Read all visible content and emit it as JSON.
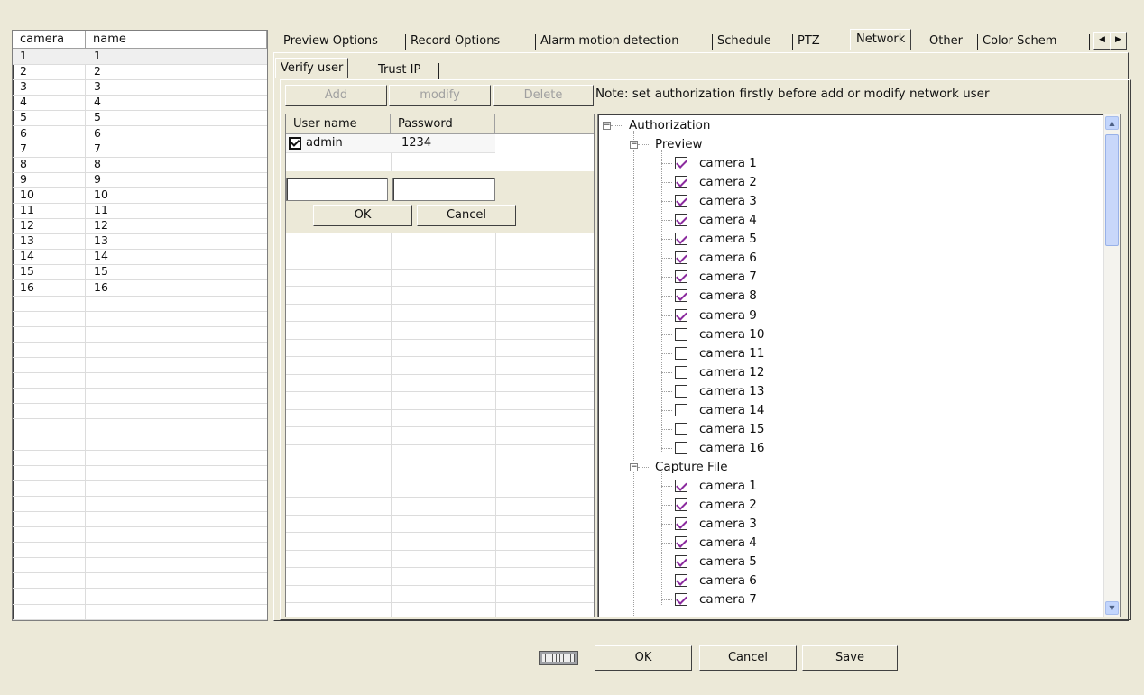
{
  "camera_list": {
    "headers": {
      "camera": "camera",
      "name": "name"
    },
    "rows": [
      {
        "camera": "1",
        "name": "1"
      },
      {
        "camera": "2",
        "name": "2"
      },
      {
        "camera": "3",
        "name": "3"
      },
      {
        "camera": "4",
        "name": "4"
      },
      {
        "camera": "5",
        "name": "5"
      },
      {
        "camera": "6",
        "name": "6"
      },
      {
        "camera": "7",
        "name": "7"
      },
      {
        "camera": "8",
        "name": "8"
      },
      {
        "camera": "9",
        "name": "9"
      },
      {
        "camera": "10",
        "name": "10"
      },
      {
        "camera": "11",
        "name": "11"
      },
      {
        "camera": "12",
        "name": "12"
      },
      {
        "camera": "13",
        "name": "13"
      },
      {
        "camera": "14",
        "name": "14"
      },
      {
        "camera": "15",
        "name": "15"
      },
      {
        "camera": "16",
        "name": "16"
      }
    ]
  },
  "tabs": [
    "Preview Options",
    "Record Options",
    "Alarm motion detection",
    "Schedule",
    "PTZ",
    "Network",
    "Other",
    "Color Schem"
  ],
  "active_tab": "Network",
  "subtabs": {
    "verify_user": "Verify user",
    "trust_ip": "Trust IP"
  },
  "user_buttons": {
    "add": "Add",
    "modify": "modify",
    "delete": "Delete"
  },
  "note": "Note: set authorization firstly before add or modify network user",
  "user_grid": {
    "headers": {
      "username": "User name",
      "password": "Password"
    },
    "rows": [
      {
        "username": "admin",
        "password": "1234",
        "checked": true
      }
    ]
  },
  "edit_buttons": {
    "ok": "OK",
    "cancel": "Cancel"
  },
  "tree": {
    "root": "Authorization",
    "preview": {
      "label": "Preview",
      "items": [
        {
          "label": "camera 1",
          "checked": true
        },
        {
          "label": "camera 2",
          "checked": true
        },
        {
          "label": "camera 3",
          "checked": true
        },
        {
          "label": "camera 4",
          "checked": true
        },
        {
          "label": "camera 5",
          "checked": true
        },
        {
          "label": "camera 6",
          "checked": true
        },
        {
          "label": "camera 7",
          "checked": true
        },
        {
          "label": "camera 8",
          "checked": true
        },
        {
          "label": "camera 9",
          "checked": true
        },
        {
          "label": "camera 10",
          "checked": false
        },
        {
          "label": "camera 11",
          "checked": false
        },
        {
          "label": "camera 12",
          "checked": false
        },
        {
          "label": "camera 13",
          "checked": false
        },
        {
          "label": "camera 14",
          "checked": false
        },
        {
          "label": "camera 15",
          "checked": false
        },
        {
          "label": "camera 16",
          "checked": false
        }
      ]
    },
    "capture": {
      "label": "Capture File",
      "items": [
        {
          "label": "camera 1",
          "checked": true
        },
        {
          "label": "camera 2",
          "checked": true
        },
        {
          "label": "camera 3",
          "checked": true
        },
        {
          "label": "camera 4",
          "checked": true
        },
        {
          "label": "camera 5",
          "checked": true
        },
        {
          "label": "camera 6",
          "checked": true
        },
        {
          "label": "camera 7",
          "checked": true
        }
      ]
    }
  },
  "footer": {
    "ok": "OK",
    "cancel": "Cancel",
    "save": "Save",
    "keyboard_icon": "keyboard-icon"
  }
}
